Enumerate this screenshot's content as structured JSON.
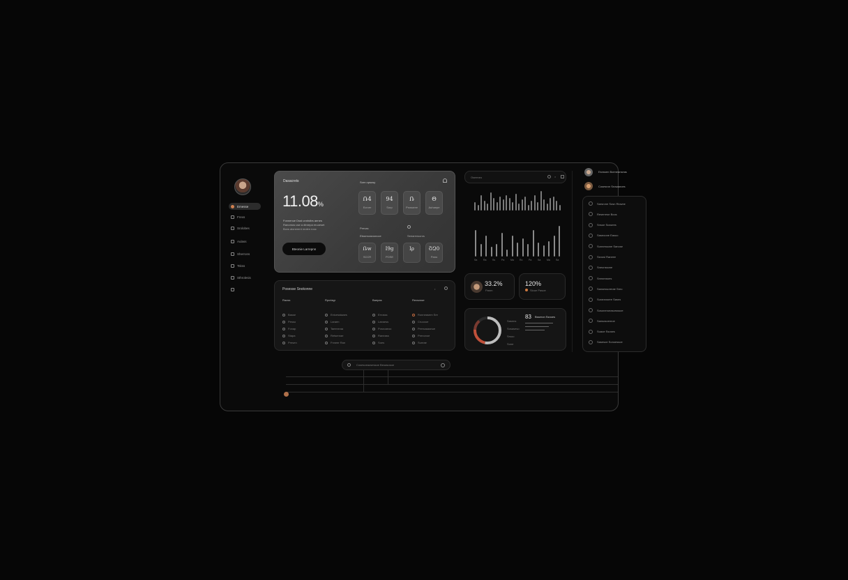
{
  "sidebar": {
    "items": [
      {
        "label": "Emesse",
        "active": true
      },
      {
        "label": "Frexs"
      },
      {
        "label": "Srolobes"
      },
      {
        "label": "Aulass"
      },
      {
        "label": "Sherrons"
      },
      {
        "label": "Tskss"
      },
      {
        "label": "Sthrolesis"
      },
      {
        "label": ""
      }
    ]
  },
  "hero": {
    "title": "Dasacrets",
    "value": "11.08",
    "unit": "%",
    "caption_1": "Fonnenue Dsst unnhdtrs aenes",
    "caption_2": "Ranomos use a dtnrepa eruoeset",
    "caption_3": "Boxs alonerent nrolen rooc",
    "button_label": "Bteonie Larrepnn",
    "right_title": "Sorn opsosy",
    "tiles": [
      {
        "value": "Ռ4",
        "label": "Ecrcer"
      },
      {
        "value": "94",
        "label": "Sorp"
      },
      {
        "value": "Ռ",
        "label": "Psnsoree"
      },
      {
        "value": "Θ",
        "label": "Auhaepe"
      }
    ],
    "sub_label_1": "Prevas",
    "sub_label_2": "Elsseroasnonoce",
    "sub_label_3": "Seearensonrs",
    "tiles2": [
      {
        "value": "Ռw",
        "label": "SCCR"
      },
      {
        "value": "Ι9ց",
        "label": "POSE"
      },
      {
        "value": "Ιρ",
        "label": ""
      },
      {
        "value": "ՇԶ0",
        "label": "Pano"
      }
    ]
  },
  "table": {
    "title": "Posesse Snokonne",
    "columns": [
      "Raoss",
      "Rpcrlagr",
      "Baepas",
      "Recsosse"
    ],
    "col1": [
      "Basse",
      "Pesso",
      "Fonap",
      "Stapa",
      "Presen"
    ],
    "col2": [
      "Extcesstaaes",
      "Laraen",
      "Taeenrraa",
      "Retsenrae",
      "Fnneer Ran"
    ],
    "col3": [
      "Errosss",
      "Laeaess",
      "Posroaeoo",
      "Raneass",
      "Soes"
    ],
    "col4": [
      "Ronneasem Sre",
      "Cruoooe",
      "Perrsaaaanue",
      "Prenonoe",
      "Sureae"
    ]
  },
  "activity": {
    "title": "Oseeneo",
    "axis_labels": [
      "Sa",
      "Ra",
      "Ss",
      "Pa",
      "Ma",
      "Ro",
      "Pa",
      "Sa",
      "Ma",
      "Sa"
    ]
  },
  "stats": {
    "card1_value": "33.2%",
    "card1_label": "Pasrn",
    "card2_value": "120%",
    "card2_label": "Sloue Pasoe"
  },
  "donut": {
    "value": "83",
    "title": "Bsseron Ssnoes",
    "legend": [
      "Sasnns",
      "Sosaseso",
      "Srsoo",
      "Sone"
    ]
  },
  "people": [
    {
      "name": "Esnssen Boeneanseas"
    },
    {
      "name": "Cosesron Srosaaroes"
    }
  ],
  "list": [
    "Sarsrone Sosn Riowne",
    "Reserrese Boos",
    "Snsoe Sussees",
    "Saseoone Easuo",
    "Sunnessone Sanose",
    "Ssnosi Raneee",
    "Sneunssone",
    "Snnsreaoes",
    "Sansessorerae Sreo",
    "Suranrosere Sasns",
    "Sosoneroeasorsssoe",
    "Sansosoenroe",
    "Suaoe Ssoses",
    "Sasesoe Sonoessoe"
  ],
  "bottom_bar": {
    "label": "Cosesoeaosessoe Beoasosoe"
  }
}
